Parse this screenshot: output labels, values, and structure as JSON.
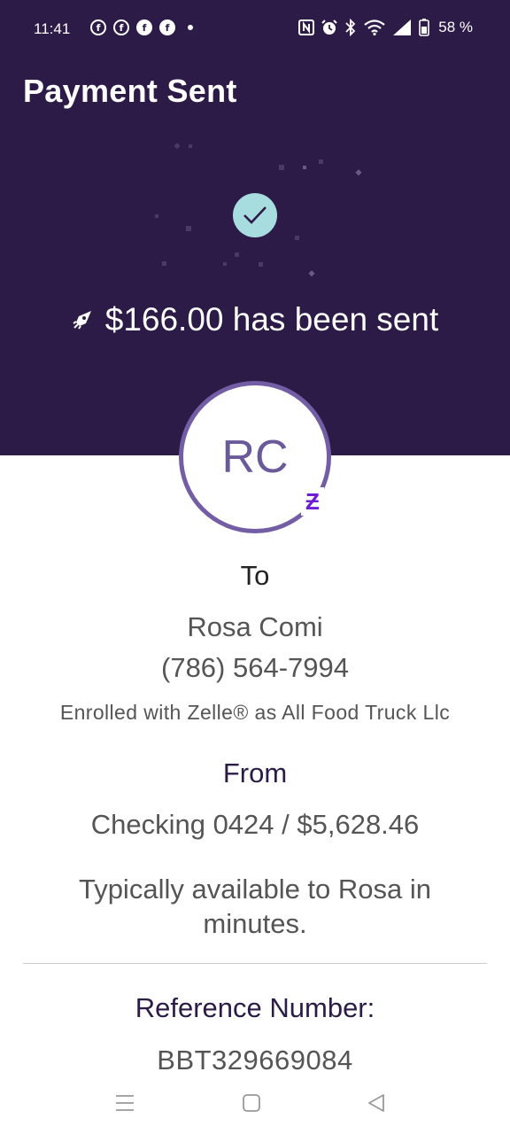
{
  "status_bar": {
    "time": "11:41",
    "battery_percent": "58 %",
    "notification_icons": [
      "facebook-outline-icon",
      "facebook-outline-icon",
      "facebook-icon",
      "facebook-icon",
      "dot-icon"
    ],
    "system_icons": [
      "nfc-icon",
      "alarm-icon",
      "bluetooth-icon",
      "wifi-icon",
      "signal-icon",
      "battery-icon"
    ]
  },
  "header": {
    "title": "Payment Sent",
    "sent_message": "$166.00 has been sent",
    "background_color": "#2d1b47",
    "check_color": "#a8dde0"
  },
  "recipient": {
    "initials": "RC",
    "to_label": "To",
    "name": "Rosa Comi",
    "phone": "(786) 564-7994",
    "enrolled": "Enrolled with Zelle® as All Food Truck Llc",
    "badge": "Ƶ",
    "ring_color": "#735ea5"
  },
  "source": {
    "from_label": "From",
    "account": "Checking 0424 / $5,628.46",
    "availability": "Typically available to Rosa in minutes."
  },
  "reference": {
    "label": "Reference Number:",
    "number": "BBT329669084"
  },
  "nav": {
    "buttons": [
      "menu-icon",
      "home-icon",
      "back-icon"
    ]
  }
}
